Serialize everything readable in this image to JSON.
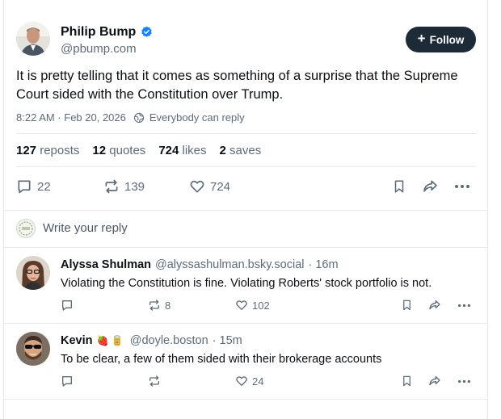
{
  "post": {
    "author_name": "Philip Bump",
    "author_handle": "@pbump.com",
    "follow_label": "Follow",
    "text": "It is pretty telling that it comes as something of a surprise that the Supreme Court sided with the Constitution over Trump.",
    "timestamp": "8:22 AM · Feb 20, 2026",
    "reply_setting": "Everybody can reply",
    "stats": {
      "reposts_count": "127",
      "reposts_label": "reposts",
      "quotes_count": "12",
      "quotes_label": "quotes",
      "likes_count": "724",
      "likes_label": "likes",
      "saves_count": "2",
      "saves_label": "saves"
    },
    "actions": {
      "replies": "22",
      "reposts": "139",
      "likes": "724"
    }
  },
  "composer": {
    "placeholder": "Write your reply"
  },
  "replies": [
    {
      "name": "Alyssa Shulman",
      "handle": "@alyssashulman.bsky.social",
      "time": "· 16m",
      "text": "Violating the Constitution is fine. Violating Roberts' stock portfolio is not.",
      "reposts": "8",
      "likes": "102"
    },
    {
      "name": "Kevin",
      "emojis": "🍓 🥫",
      "handle": "@doyle.boston",
      "time": "· 15m",
      "text": "To be clear, a few of them sided with their brokerage accounts",
      "reposts": "",
      "likes": "24"
    }
  ],
  "colors": {
    "accent": "#1083fe",
    "follow_bg": "#1d2a38",
    "muted": "#5c6b7a",
    "divider": "#e6e9ed"
  }
}
